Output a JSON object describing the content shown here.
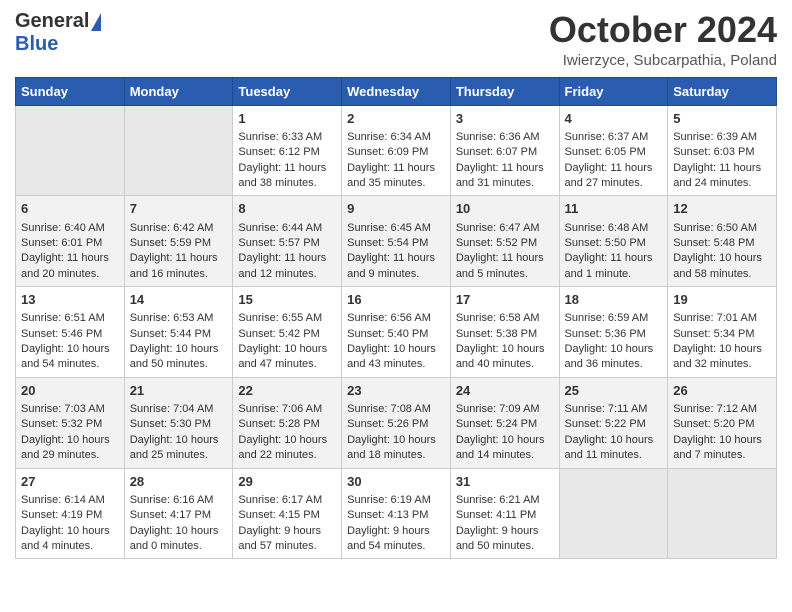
{
  "logo": {
    "general": "General",
    "blue": "Blue"
  },
  "title": "October 2024",
  "subtitle": "Iwierzyce, Subcarpathia, Poland",
  "days_of_week": [
    "Sunday",
    "Monday",
    "Tuesday",
    "Wednesday",
    "Thursday",
    "Friday",
    "Saturday"
  ],
  "rows": [
    [
      {
        "day": "",
        "lines": []
      },
      {
        "day": "",
        "lines": []
      },
      {
        "day": "1",
        "lines": [
          "Sunrise: 6:33 AM",
          "Sunset: 6:12 PM",
          "Daylight: 11 hours",
          "and 38 minutes."
        ]
      },
      {
        "day": "2",
        "lines": [
          "Sunrise: 6:34 AM",
          "Sunset: 6:09 PM",
          "Daylight: 11 hours",
          "and 35 minutes."
        ]
      },
      {
        "day": "3",
        "lines": [
          "Sunrise: 6:36 AM",
          "Sunset: 6:07 PM",
          "Daylight: 11 hours",
          "and 31 minutes."
        ]
      },
      {
        "day": "4",
        "lines": [
          "Sunrise: 6:37 AM",
          "Sunset: 6:05 PM",
          "Daylight: 11 hours",
          "and 27 minutes."
        ]
      },
      {
        "day": "5",
        "lines": [
          "Sunrise: 6:39 AM",
          "Sunset: 6:03 PM",
          "Daylight: 11 hours",
          "and 24 minutes."
        ]
      }
    ],
    [
      {
        "day": "6",
        "lines": [
          "Sunrise: 6:40 AM",
          "Sunset: 6:01 PM",
          "Daylight: 11 hours",
          "and 20 minutes."
        ]
      },
      {
        "day": "7",
        "lines": [
          "Sunrise: 6:42 AM",
          "Sunset: 5:59 PM",
          "Daylight: 11 hours",
          "and 16 minutes."
        ]
      },
      {
        "day": "8",
        "lines": [
          "Sunrise: 6:44 AM",
          "Sunset: 5:57 PM",
          "Daylight: 11 hours",
          "and 12 minutes."
        ]
      },
      {
        "day": "9",
        "lines": [
          "Sunrise: 6:45 AM",
          "Sunset: 5:54 PM",
          "Daylight: 11 hours",
          "and 9 minutes."
        ]
      },
      {
        "day": "10",
        "lines": [
          "Sunrise: 6:47 AM",
          "Sunset: 5:52 PM",
          "Daylight: 11 hours",
          "and 5 minutes."
        ]
      },
      {
        "day": "11",
        "lines": [
          "Sunrise: 6:48 AM",
          "Sunset: 5:50 PM",
          "Daylight: 11 hours",
          "and 1 minute."
        ]
      },
      {
        "day": "12",
        "lines": [
          "Sunrise: 6:50 AM",
          "Sunset: 5:48 PM",
          "Daylight: 10 hours",
          "and 58 minutes."
        ]
      }
    ],
    [
      {
        "day": "13",
        "lines": [
          "Sunrise: 6:51 AM",
          "Sunset: 5:46 PM",
          "Daylight: 10 hours",
          "and 54 minutes."
        ]
      },
      {
        "day": "14",
        "lines": [
          "Sunrise: 6:53 AM",
          "Sunset: 5:44 PM",
          "Daylight: 10 hours",
          "and 50 minutes."
        ]
      },
      {
        "day": "15",
        "lines": [
          "Sunrise: 6:55 AM",
          "Sunset: 5:42 PM",
          "Daylight: 10 hours",
          "and 47 minutes."
        ]
      },
      {
        "day": "16",
        "lines": [
          "Sunrise: 6:56 AM",
          "Sunset: 5:40 PM",
          "Daylight: 10 hours",
          "and 43 minutes."
        ]
      },
      {
        "day": "17",
        "lines": [
          "Sunrise: 6:58 AM",
          "Sunset: 5:38 PM",
          "Daylight: 10 hours",
          "and 40 minutes."
        ]
      },
      {
        "day": "18",
        "lines": [
          "Sunrise: 6:59 AM",
          "Sunset: 5:36 PM",
          "Daylight: 10 hours",
          "and 36 minutes."
        ]
      },
      {
        "day": "19",
        "lines": [
          "Sunrise: 7:01 AM",
          "Sunset: 5:34 PM",
          "Daylight: 10 hours",
          "and 32 minutes."
        ]
      }
    ],
    [
      {
        "day": "20",
        "lines": [
          "Sunrise: 7:03 AM",
          "Sunset: 5:32 PM",
          "Daylight: 10 hours",
          "and 29 minutes."
        ]
      },
      {
        "day": "21",
        "lines": [
          "Sunrise: 7:04 AM",
          "Sunset: 5:30 PM",
          "Daylight: 10 hours",
          "and 25 minutes."
        ]
      },
      {
        "day": "22",
        "lines": [
          "Sunrise: 7:06 AM",
          "Sunset: 5:28 PM",
          "Daylight: 10 hours",
          "and 22 minutes."
        ]
      },
      {
        "day": "23",
        "lines": [
          "Sunrise: 7:08 AM",
          "Sunset: 5:26 PM",
          "Daylight: 10 hours",
          "and 18 minutes."
        ]
      },
      {
        "day": "24",
        "lines": [
          "Sunrise: 7:09 AM",
          "Sunset: 5:24 PM",
          "Daylight: 10 hours",
          "and 14 minutes."
        ]
      },
      {
        "day": "25",
        "lines": [
          "Sunrise: 7:11 AM",
          "Sunset: 5:22 PM",
          "Daylight: 10 hours",
          "and 11 minutes."
        ]
      },
      {
        "day": "26",
        "lines": [
          "Sunrise: 7:12 AM",
          "Sunset: 5:20 PM",
          "Daylight: 10 hours",
          "and 7 minutes."
        ]
      }
    ],
    [
      {
        "day": "27",
        "lines": [
          "Sunrise: 6:14 AM",
          "Sunset: 4:19 PM",
          "Daylight: 10 hours",
          "and 4 minutes."
        ]
      },
      {
        "day": "28",
        "lines": [
          "Sunrise: 6:16 AM",
          "Sunset: 4:17 PM",
          "Daylight: 10 hours",
          "and 0 minutes."
        ]
      },
      {
        "day": "29",
        "lines": [
          "Sunrise: 6:17 AM",
          "Sunset: 4:15 PM",
          "Daylight: 9 hours",
          "and 57 minutes."
        ]
      },
      {
        "day": "30",
        "lines": [
          "Sunrise: 6:19 AM",
          "Sunset: 4:13 PM",
          "Daylight: 9 hours",
          "and 54 minutes."
        ]
      },
      {
        "day": "31",
        "lines": [
          "Sunrise: 6:21 AM",
          "Sunset: 4:11 PM",
          "Daylight: 9 hours",
          "and 50 minutes."
        ]
      },
      {
        "day": "",
        "lines": []
      },
      {
        "day": "",
        "lines": []
      }
    ]
  ]
}
